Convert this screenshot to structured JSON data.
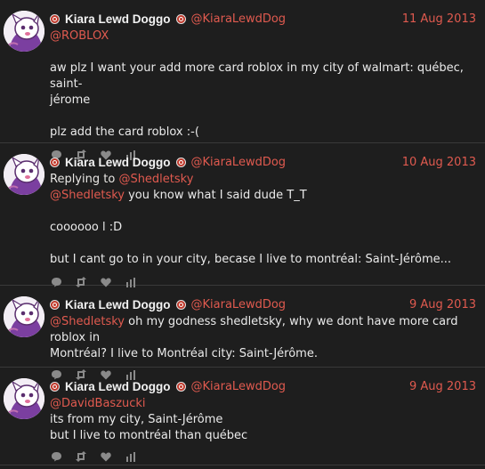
{
  "tweets": [
    {
      "display_name": "Kiara Lewd Doggo",
      "handle": "@KiaraLewdDog",
      "date": "11 Aug 2013",
      "mention": "@ROBLOX",
      "lines": [
        "aw plz I want your add more card roblox in my city of walmart: québec, saint-",
        "jérome",
        "",
        "plz add the card roblox :-("
      ]
    },
    {
      "display_name": "Kiara Lewd Doggo",
      "handle": "@KiaraLewdDog",
      "date": "10 Aug 2013",
      "replying_prefix": "Replying to",
      "replying_handle": "@Shedletsky",
      "mention": "@Shedletsky",
      "mention_rest": " you know what I said dude T_T",
      "lines": [
        "",
        "coooooo l :D",
        "",
        "but I cant go to in your city, becase I live to montréal: Saint-Jérôme..."
      ]
    },
    {
      "display_name": "Kiara Lewd Doggo",
      "handle": "@KiaraLewdDog",
      "date": "9 Aug 2013",
      "mention": "@Shedletsky",
      "mention_rest": " oh my godness shedletsky, why we dont have more card roblox in",
      "lines": [
        "Montréal? I live to Montréal city: Saint-Jérôme."
      ]
    },
    {
      "display_name": "Kiara Lewd Doggo",
      "handle": "@KiaraLewdDog",
      "date": "9 Aug 2013",
      "mention": "@DavidBaszucki",
      "lines": [
        "its from my city, Saint-Jérôme",
        "but I live to montréal than québec"
      ]
    }
  ],
  "icons": {
    "badge": "roblox-badge-icon",
    "reply": "reply-icon",
    "retweet": "retweet-icon",
    "like": "heart-icon",
    "stats": "stats-icon"
  },
  "colors": {
    "background": "#1e1e1e",
    "accent": "#e05a4f",
    "text": "#eaeaea",
    "muted": "#8a8a8a",
    "divider": "#3a3a3a"
  }
}
